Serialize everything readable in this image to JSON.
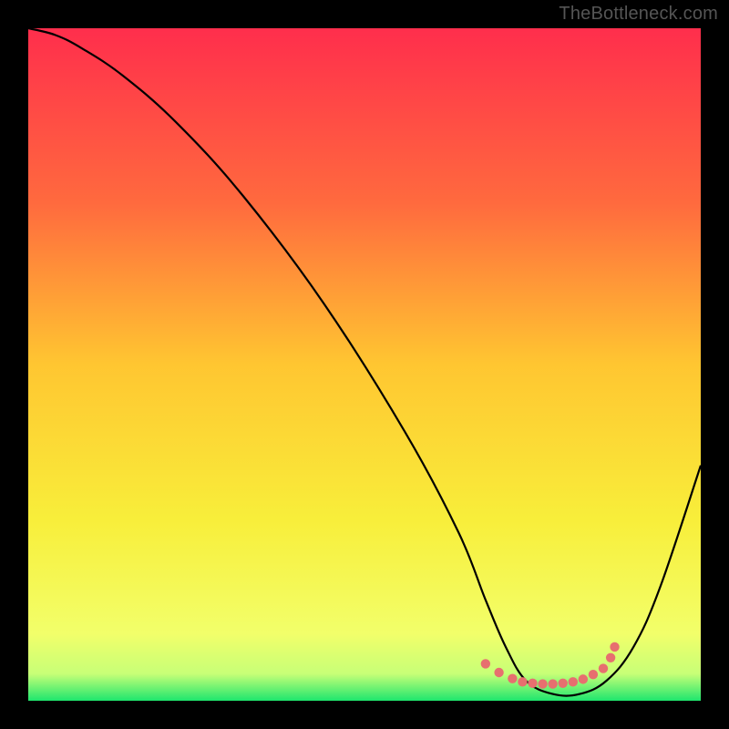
{
  "watermark": "TheBottleneck.com",
  "chart_data": {
    "type": "line",
    "title": "",
    "xlabel": "",
    "ylabel": "",
    "xlim": [
      0,
      100
    ],
    "ylim": [
      0,
      100
    ],
    "gradient_stops": [
      {
        "offset": 0,
        "color": "#ff2e4c"
      },
      {
        "offset": 26,
        "color": "#ff6a3e"
      },
      {
        "offset": 50,
        "color": "#ffc631"
      },
      {
        "offset": 73,
        "color": "#f8ee3a"
      },
      {
        "offset": 90,
        "color": "#f2ff6a"
      },
      {
        "offset": 96,
        "color": "#c7ff77"
      },
      {
        "offset": 100,
        "color": "#1ee66e"
      }
    ],
    "series": [
      {
        "name": "bottleneck-curve",
        "x": [
          0,
          4,
          8,
          14,
          22,
          32,
          44,
          56,
          64,
          68,
          71,
          74,
          78,
          82,
          86,
          90,
          94,
          100
        ],
        "y": [
          100,
          99,
          97,
          93,
          86,
          75,
          59,
          40,
          25,
          15,
          8,
          3,
          1,
          1,
          3,
          8,
          17,
          35
        ]
      }
    ],
    "markers": {
      "name": "optimal-range",
      "color": "#e76f6f",
      "points": [
        {
          "x": 68,
          "y": 5.5
        },
        {
          "x": 70,
          "y": 4.2
        },
        {
          "x": 72,
          "y": 3.3
        },
        {
          "x": 73.5,
          "y": 2.8
        },
        {
          "x": 75,
          "y": 2.6
        },
        {
          "x": 76.5,
          "y": 2.5
        },
        {
          "x": 78,
          "y": 2.5
        },
        {
          "x": 79.5,
          "y": 2.6
        },
        {
          "x": 81,
          "y": 2.8
        },
        {
          "x": 82.5,
          "y": 3.2
        },
        {
          "x": 84,
          "y": 3.9
        },
        {
          "x": 85.5,
          "y": 4.8
        },
        {
          "x": 86.6,
          "y": 6.4
        },
        {
          "x": 87.2,
          "y": 8.0
        }
      ]
    }
  }
}
